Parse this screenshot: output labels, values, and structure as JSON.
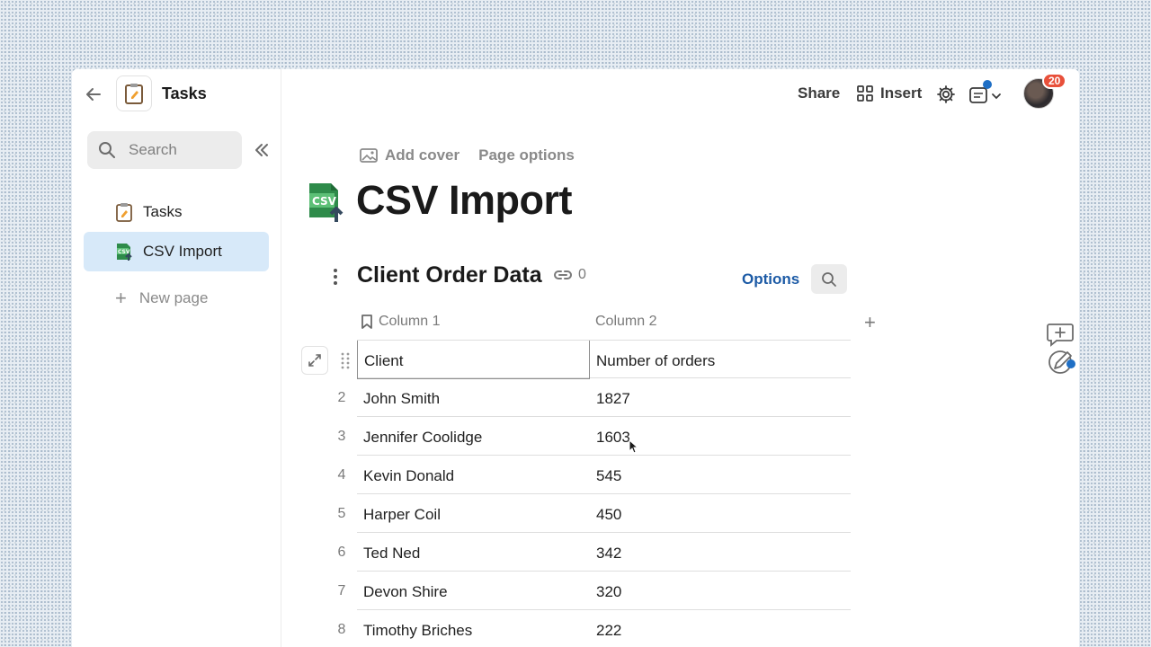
{
  "sidebar": {
    "app_title": "Tasks",
    "search_placeholder": "Search",
    "items": [
      {
        "label": "Tasks",
        "icon": "clipboard-icon",
        "active": false
      },
      {
        "label": "CSV Import",
        "icon": "csv-file-icon",
        "active": true
      }
    ],
    "new_page_label": "New page"
  },
  "topbar": {
    "share_label": "Share",
    "insert_label": "Insert",
    "notification_badge": "20"
  },
  "page": {
    "add_cover_label": "Add cover",
    "page_options_label": "Page options",
    "title": "CSV Import"
  },
  "table": {
    "title": "Client Order Data",
    "link_count": "0",
    "options_label": "Options",
    "columns": [
      "Column 1",
      "Column 2"
    ],
    "rows": [
      {
        "index": "",
        "c1": "Client",
        "c2": "Number of orders"
      },
      {
        "index": "2",
        "c1": "John Smith",
        "c2": "1827"
      },
      {
        "index": "3",
        "c1": "Jennifer Coolidge",
        "c2": "1603"
      },
      {
        "index": "4",
        "c1": "Kevin Donald",
        "c2": "545"
      },
      {
        "index": "5",
        "c1": "Harper Coil",
        "c2": "450"
      },
      {
        "index": "6",
        "c1": "Ted Ned",
        "c2": "342"
      },
      {
        "index": "7",
        "c1": "Devon Shire",
        "c2": "320"
      },
      {
        "index": "8",
        "c1": "Timothy Briches",
        "c2": "222"
      }
    ]
  },
  "colors": {
    "accent": "#1d5ba6",
    "active_nav_bg": "#d7e9f9",
    "badge": "#e8503a"
  }
}
